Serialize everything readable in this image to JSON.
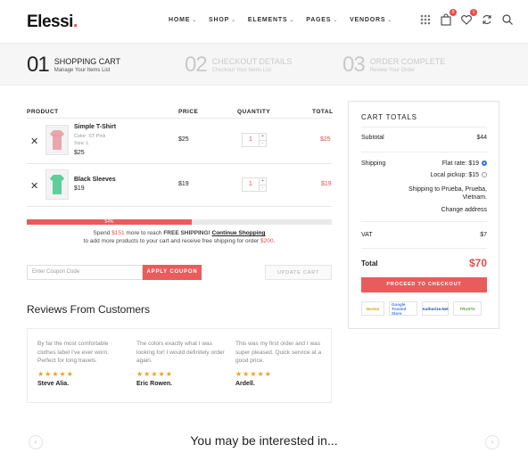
{
  "brand": {
    "name": "Elessi",
    "dot": "."
  },
  "nav": {
    "items": [
      "HOME",
      "SHOP",
      "ELEMENTS",
      "PAGES",
      "VENDORS"
    ]
  },
  "header_icons": {
    "compare_badge": "0",
    "wishlist_badge": "1",
    "cart_badge": "",
    "icons": [
      "grid-icon",
      "bag-icon",
      "heart-icon",
      "refresh-icon",
      "search-icon"
    ]
  },
  "steps": [
    {
      "num": "01",
      "title": "SHOPPING CART",
      "sub": "Manage Your Items List",
      "active": true
    },
    {
      "num": "02",
      "title": "CHECKOUT DETAILS",
      "sub": "Checkout Your Items List",
      "active": false
    },
    {
      "num": "03",
      "title": "ORDER COMPLETE",
      "sub": "Review Your Order",
      "active": false
    }
  ],
  "table": {
    "headers": {
      "product": "PRODUCT",
      "price": "PRICE",
      "quantity": "QUANTITY",
      "total": "TOTAL"
    }
  },
  "items": [
    {
      "name": "Simple T-Shirt",
      "color": "Color: ST Pink",
      "size": "Size: L",
      "subprice": "$25",
      "price": "$25",
      "qty": "1",
      "total": "$25",
      "swatch": "#e8a7ad"
    },
    {
      "name": "Black Sleeves",
      "subprice": "$19",
      "price": "$19",
      "qty": "1",
      "total": "$19",
      "swatch": "#5fcf9a"
    }
  ],
  "shipping_progress": {
    "percent": 54,
    "label": "54%",
    "spend_pre": "Spend ",
    "amount": "$151",
    "spend_mid": " more to reach ",
    "free": "FREE SHIPPING!",
    "link": "Continue Shopping",
    "line2_pre": "to add more products to your cart and receive free shipping for order ",
    "line2_amt": "$200",
    "line2_end": "."
  },
  "coupon": {
    "placeholder": "Enter Coupon Code",
    "apply": "APPLY COUPON",
    "update": "UPDATE CART"
  },
  "reviews": {
    "title": "Reviews From Customers",
    "items": [
      {
        "text": "By far the most comfortable clothes label I've ever worn. Perfect for long travels.",
        "stars": "★★★★★",
        "author": "Steve Alia."
      },
      {
        "text": "The colors exactly what I was looking for! I would definitely order again.",
        "stars": "★★★★★",
        "author": "Eric Rowen."
      },
      {
        "text": "This was my first order and I was super pleased. Quick service at a good price.",
        "stars": "★★★★★",
        "author": "Ardell."
      }
    ]
  },
  "totals": {
    "title": "CART TOTALS",
    "subtotal_label": "Subtotal",
    "subtotal": "$44",
    "shipping_label": "Shipping",
    "flat": "Flat rate: $19",
    "local": "Local pickup: $15",
    "ship_to": "Shipping to Prueba, Prueba, Vietnam.",
    "change": "Change address",
    "vat_label": "VAT",
    "vat": "$7",
    "total_label": "Total",
    "total": "$70",
    "checkout": "PROCEED TO CHECKOUT",
    "badges": [
      "Norton",
      "Google Trusted Store",
      "Authorize.Net",
      "TRUSTe"
    ]
  },
  "bottom": {
    "title": "You may be interested in...",
    "prev": "‹",
    "next": "›"
  }
}
